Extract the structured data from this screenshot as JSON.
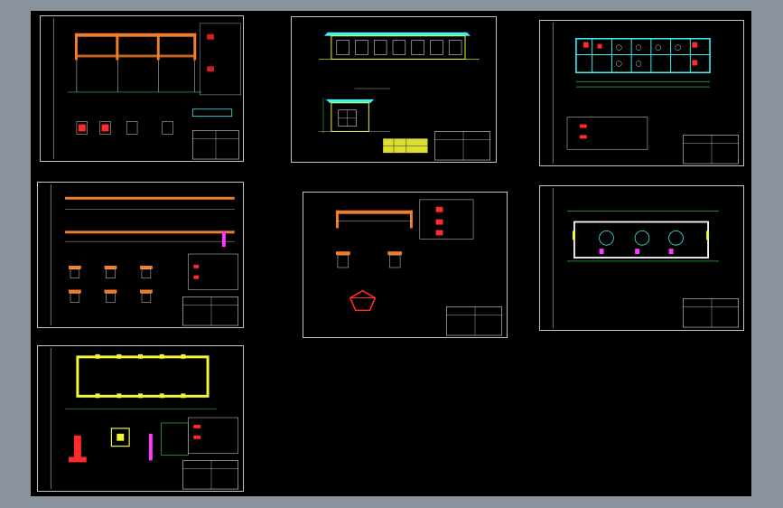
{
  "colors": {
    "background": "#8a939d",
    "canvas": "#000000",
    "frame": "#bfc4c8",
    "beam": "#f07e2a",
    "grid": "#2ee05a",
    "wall": "#f5f53a",
    "cyan": "#3ef0f0",
    "red": "#ff2a2a",
    "magenta": "#ff3aff"
  },
  "sheets": [
    {
      "id": "sheet-1",
      "icon": "frame-elevation-drawing"
    },
    {
      "id": "sheet-2",
      "icon": "building-elevation-drawing"
    },
    {
      "id": "sheet-3",
      "icon": "floor-slab-plan-drawing"
    },
    {
      "id": "sheet-4",
      "icon": "beam-elevation-drawing"
    },
    {
      "id": "sheet-5",
      "icon": "single-beam-detail-drawing"
    },
    {
      "id": "sheet-6",
      "icon": "foundation-plan-drawing"
    },
    {
      "id": "sheet-7",
      "icon": "wall-layout-plan-drawing"
    }
  ]
}
